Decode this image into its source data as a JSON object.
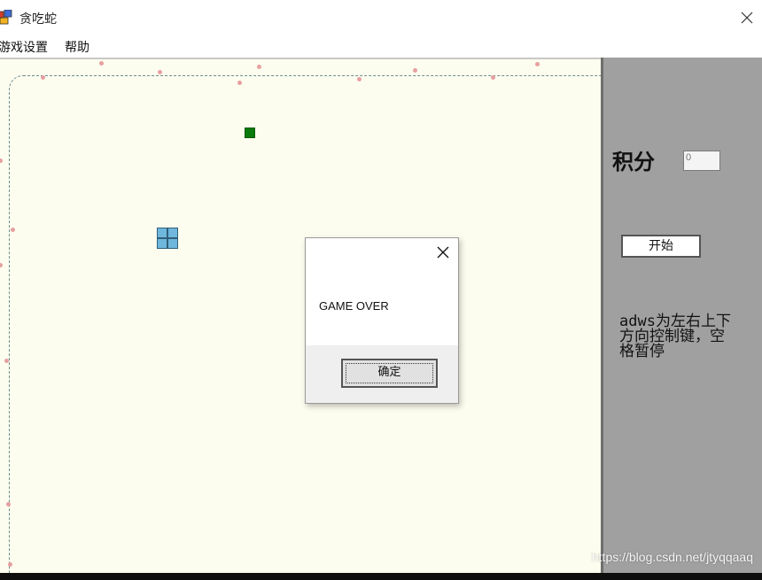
{
  "window": {
    "title": "贪吃蛇",
    "close_icon": "close-icon",
    "app_icon": "app-icon"
  },
  "menu": {
    "items": [
      {
        "label": "游戏设置"
      },
      {
        "label": "帮助"
      }
    ]
  },
  "game": {
    "food_color": "#0a7a0a",
    "snake_color": "#6fb7dc"
  },
  "side_panel": {
    "score_label": "积分",
    "score_value": "0",
    "start_button": "开始",
    "help_text": "adws为左右上下方向控制键，空格暂停"
  },
  "dialog": {
    "message": "GAME OVER",
    "ok_button": "确定"
  },
  "watermark": "https://blog.csdn.net/jtyqqaaq"
}
